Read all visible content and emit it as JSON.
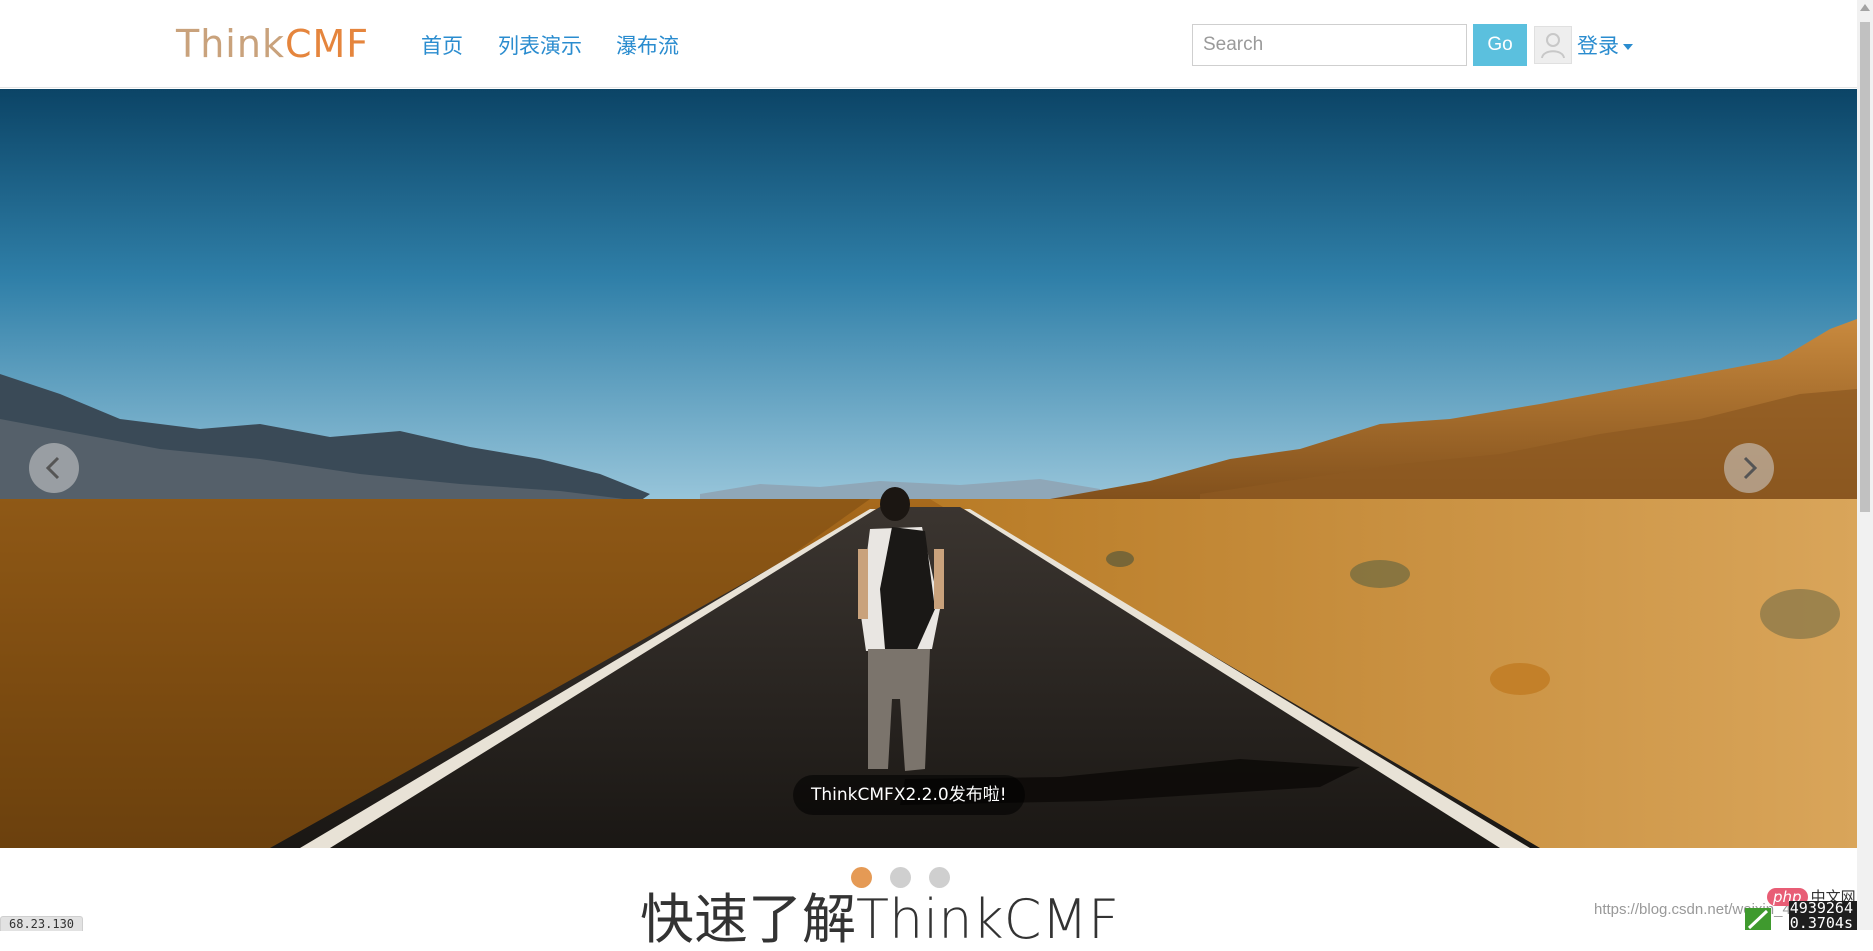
{
  "nav": {
    "brand_part1": "Think",
    "brand_part2": "CMF",
    "links": [
      "首页",
      "列表演示",
      "瀑布流"
    ],
    "search_placeholder": "Search",
    "go_label": "Go",
    "login_label": "登录"
  },
  "carousel": {
    "caption": "ThinkCMFX2.2.0发布啦!",
    "slide_count": 3,
    "active_index": 0,
    "prev_icon": "chevron-left-icon",
    "next_icon": "chevron-right-icon"
  },
  "main": {
    "headline": "快速了解ThinkCMF"
  },
  "overlays": {
    "debug_text": "68.23.130",
    "watermark": "https://blog.csdn.net/weixin_4939264",
    "php_label": "php",
    "cn_label": "中文网",
    "perf_line1": "4939264",
    "perf_line2": "0.3704s"
  },
  "colors": {
    "link": "#2a8ccf",
    "brand_orange": "#e5853d",
    "go_button": "#5bc0de",
    "active_dot": "#e59a55"
  }
}
